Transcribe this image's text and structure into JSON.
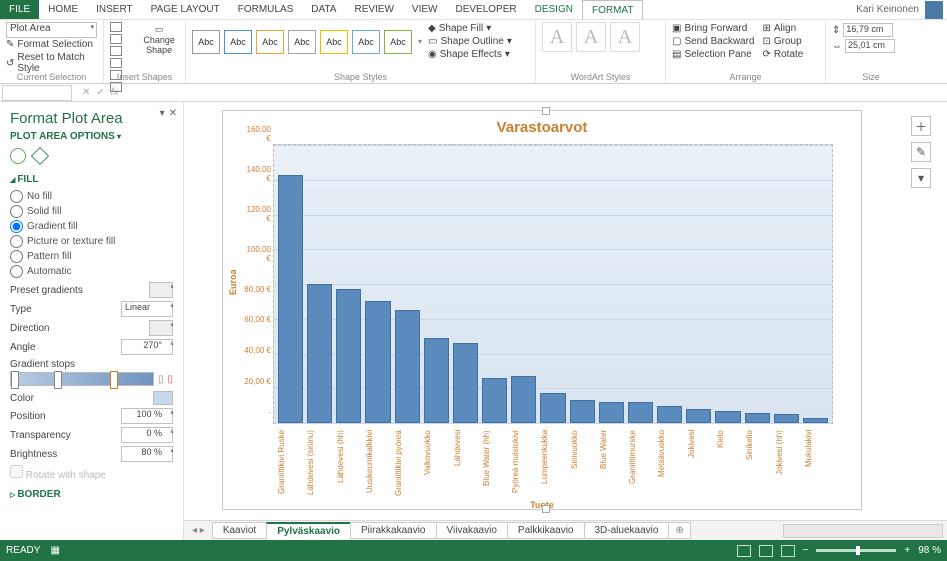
{
  "tabs": {
    "file": "FILE",
    "home": "HOME",
    "insert": "INSERT",
    "pageLayout": "PAGE LAYOUT",
    "formulas": "FORMULAS",
    "data": "DATA",
    "review": "REVIEW",
    "view": "VIEW",
    "developer": "DEVELOPER",
    "design": "DESIGN",
    "format": "FORMAT"
  },
  "user": "Kari Keinonen",
  "ribbon": {
    "currentSel": {
      "dropdown": "Plot Area",
      "formatSel": "Format Selection",
      "reset": "Reset to Match Style",
      "group": "Current Selection"
    },
    "insertShapes": {
      "change": "Change Shape",
      "group": "Insert Shapes"
    },
    "shapeStyles": {
      "abc": "Abc",
      "fill": "Shape Fill",
      "outline": "Shape Outline",
      "effects": "Shape Effects",
      "group": "Shape Styles"
    },
    "wordart": {
      "group": "WordArt Styles"
    },
    "arrange": {
      "forward": "Bring Forward",
      "backward": "Send Backward",
      "selpane": "Selection Pane",
      "align": "Align",
      "grp": "Group",
      "rotate": "Rotate",
      "group": "Arrange"
    },
    "size": {
      "h": "16,79 cm",
      "w": "25,01 cm",
      "group": "Size"
    }
  },
  "pane": {
    "title": "Format Plot Area",
    "sub": "PLOT AREA OPTIONS",
    "fill": "FILL",
    "radios": {
      "nofill": "No fill",
      "solid": "Solid fill",
      "gradient": "Gradient fill",
      "picture": "Picture or texture fill",
      "pattern": "Pattern fill",
      "auto": "Automatic"
    },
    "preset": "Preset gradients",
    "type": "Type",
    "typeVal": "Linear",
    "direction": "Direction",
    "angle": "Angle",
    "angleVal": "270°",
    "stops": "Gradient stops",
    "color": "Color",
    "position": "Position",
    "positionVal": "100 %",
    "transparency": "Transparency",
    "transparencyVal": "0 %",
    "brightness": "Brightness",
    "brightnessVal": "80 %",
    "rotate": "Rotate with shape",
    "border": "BORDER"
  },
  "chart_data": {
    "type": "bar",
    "title": "Varastoarvot",
    "ylabel": "Euroa",
    "xlabel": "Tuote",
    "ylim": [
      0,
      160
    ],
    "ystep": 20,
    "yticks": [
      "160,00 €",
      "140,00 €",
      "120,00 €",
      "100,00 €",
      "80,00 €",
      "60,00 €",
      "40,00 €",
      "20,00 €",
      "-"
    ],
    "categories": [
      "Graniittikivi Ruske",
      "Lähdevesi (sininu)",
      "Lähdevesi (hh)",
      "Uusikeumikalkkivi",
      "Graniittikivi pyöreä",
      "Valkovuokko",
      "Lähdevesi",
      "Blue Water (hh)",
      "Pyöreä muistokivi",
      "Lumpeenkukka",
      "Sinivuokko",
      "Blue Water",
      "Graniittimurske",
      "Metsävuokko",
      "Jokivesi",
      "Kielo",
      "Sinikello",
      "Jokivesi (hh)",
      "Mukulakivi"
    ],
    "values": [
      143,
      80,
      77,
      70,
      65,
      49,
      46,
      26,
      27,
      17,
      13,
      12,
      12,
      10,
      8,
      7,
      6,
      5,
      3
    ]
  },
  "sheets": {
    "nav": "◂  ▸",
    "kaaviot": "Kaaviot",
    "pylvas": "Pylväskaavio",
    "piirakka": "Piirakkakaavio",
    "viiva": "Viivakaavio",
    "palkki": "Palkkikaavio",
    "alue": "3D-aluekaavio",
    "add": "⊕"
  },
  "status": {
    "ready": "READY",
    "zoom": "98 %"
  }
}
